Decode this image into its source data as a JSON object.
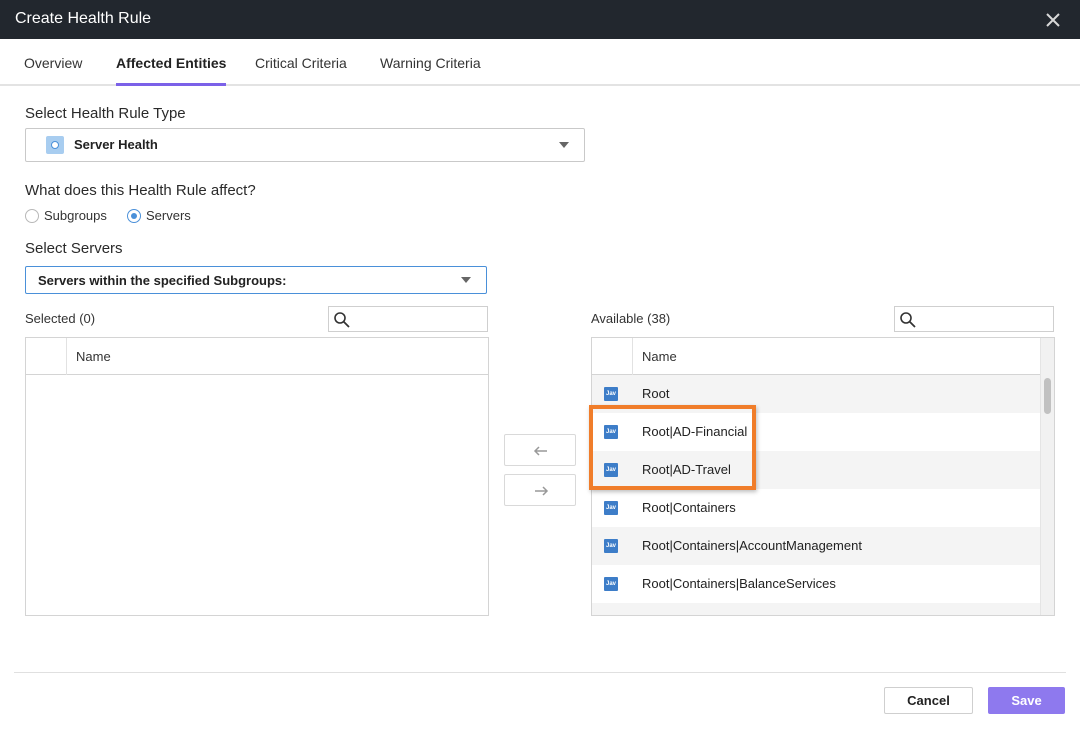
{
  "dialog": {
    "title": "Create Health Rule"
  },
  "tabs": [
    {
      "label": "Overview",
      "active": false
    },
    {
      "label": "Affected Entities",
      "active": true
    },
    {
      "label": "Critical Criteria",
      "active": false
    },
    {
      "label": "Warning Criteria",
      "active": false
    }
  ],
  "rule_type": {
    "label": "Select Health Rule Type",
    "selected": "Server Health",
    "icon": "server-health-icon"
  },
  "affect": {
    "label": "What does this Health Rule affect?",
    "options": [
      {
        "label": "Subgroups",
        "checked": false
      },
      {
        "label": "Servers",
        "checked": true
      }
    ]
  },
  "servers": {
    "label": "Select Servers",
    "scope_selected": "Servers within the specified Subgroups:"
  },
  "selected_list": {
    "heading": "Selected (0)",
    "column": "Name",
    "rows": []
  },
  "available_list": {
    "heading": "Available (38)",
    "column": "Name",
    "row_icon_text": "Jav",
    "rows": [
      "Root",
      "Root|AD-Financial",
      "Root|AD-Travel",
      "Root|Containers",
      "Root|Containers|AccountManagement",
      "Root|Containers|BalanceServices"
    ]
  },
  "highlight_color": "#f07d2a",
  "accent_color": "#7b61e8",
  "footer": {
    "cancel_label": "Cancel",
    "save_label": "Save"
  }
}
